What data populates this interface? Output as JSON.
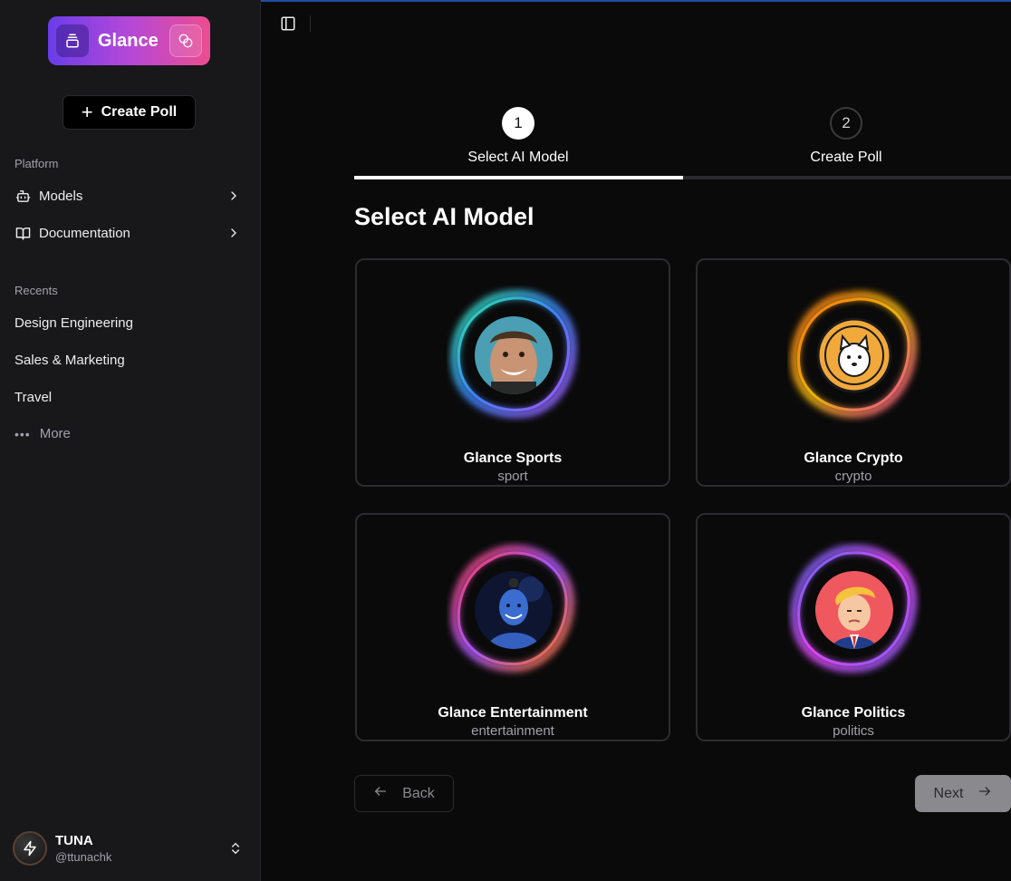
{
  "brand": {
    "name": "Glance"
  },
  "sidebar": {
    "create_poll_label": "Create Poll",
    "platform_label": "Platform",
    "platform_items": [
      {
        "label": "Models",
        "icon": "bot-icon"
      },
      {
        "label": "Documentation",
        "icon": "book-open-icon"
      }
    ],
    "recents_label": "Recents",
    "recents": [
      {
        "label": "Design Engineering"
      },
      {
        "label": "Sales & Marketing"
      },
      {
        "label": "Travel"
      }
    ],
    "more_label": "More",
    "user": {
      "name": "TUNA",
      "handle": "@ttunachk"
    }
  },
  "stepper": {
    "steps": [
      {
        "number": "1",
        "label": "Select AI Model",
        "active": true
      },
      {
        "number": "2",
        "label": "Create Poll",
        "active": false
      }
    ],
    "progress_fraction": 0.5
  },
  "main": {
    "title": "Select AI Model",
    "models": [
      {
        "name": "Glance Sports",
        "tag": "sport",
        "aura": [
          "#2ee6a8",
          "#3b82f6",
          "#a855f7"
        ]
      },
      {
        "name": "Glance Crypto",
        "tag": "crypto",
        "aura": [
          "#f97316",
          "#eab308",
          "#ec4899"
        ]
      },
      {
        "name": "Glance Entertainment",
        "tag": "entertainment",
        "aura": [
          "#f43f5e",
          "#a855f7",
          "#f97316"
        ]
      },
      {
        "name": "Glance Politics",
        "tag": "politics",
        "aura": [
          "#6366f1",
          "#d946ef",
          "#8b5cf6"
        ]
      }
    ],
    "back_label": "Back",
    "next_label": "Next"
  },
  "colors": {
    "background": "#0a0a0a",
    "sidebar": "#18181b",
    "accent_gradient": [
      "#6a3de8",
      "#b548d8",
      "#ec4d8f"
    ]
  }
}
